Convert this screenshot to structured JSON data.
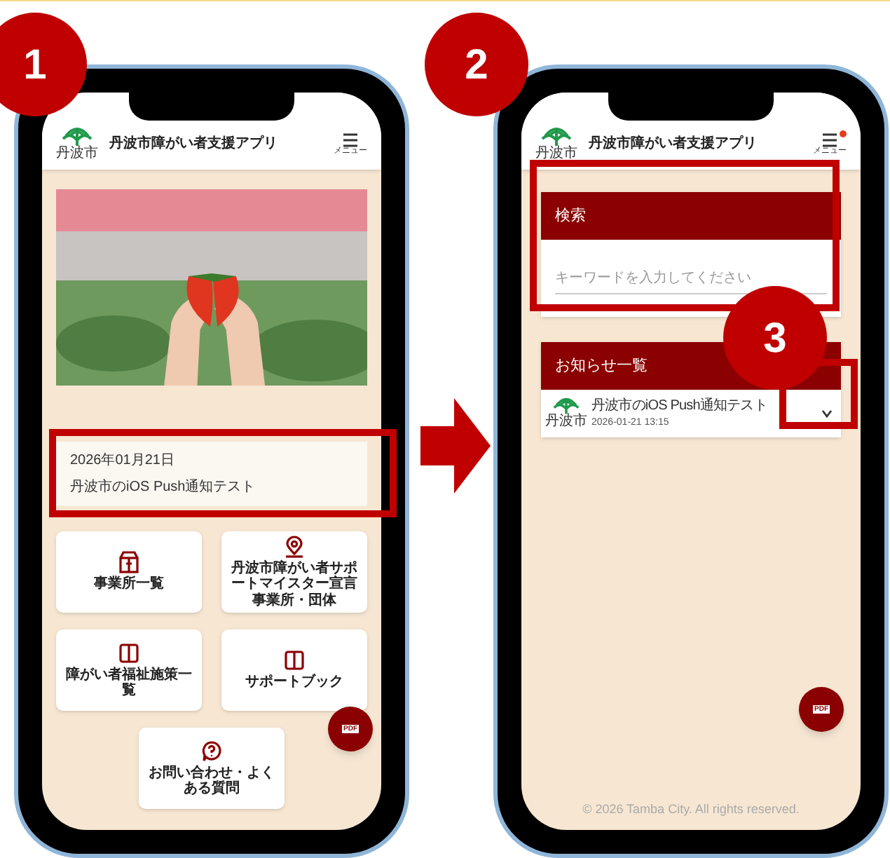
{
  "steps": [
    {
      "number": "1"
    },
    {
      "number": "2"
    },
    {
      "number": "3"
    }
  ],
  "screen_1": {
    "app_title": "丹波市障がい者支援アプリ",
    "logo_text": "丹波市",
    "menu_label": "メニュー",
    "menu_badge": false,
    "notice": {
      "date": "2026年01月21日",
      "title": "丹波市のiOS Push通知テスト"
    },
    "tiles": [
      {
        "label": "事業所一覧",
        "kind": "building"
      },
      {
        "label": "丹波市障がい者サポートマイスター宣言事業所・団体",
        "kind": "pin"
      },
      {
        "label": "障がい者福祉施策一覧",
        "kind": "book"
      },
      {
        "label": "サポートブック",
        "kind": "book"
      },
      {
        "label": "お問い合わせ・よくある質問",
        "kind": "question"
      }
    ],
    "fab_label": "PDF"
  },
  "screen_2": {
    "app_title": "丹波市障がい者支援アプリ",
    "logo_text": "丹波市",
    "menu_label": "メニュー",
    "menu_badge": true,
    "search": {
      "title": "検索",
      "placeholder": "キーワードを入力してください"
    },
    "notices": {
      "title": "お知らせ一覧",
      "items": [
        {
          "title": "丹波市のiOS Push通知テスト",
          "time": "2026-01-21 13:15",
          "logo_text": "丹波市",
          "expanded": false
        }
      ]
    },
    "fab_label": "PDF",
    "footer": "© 2026 Tamba City. All rights reserved."
  }
}
